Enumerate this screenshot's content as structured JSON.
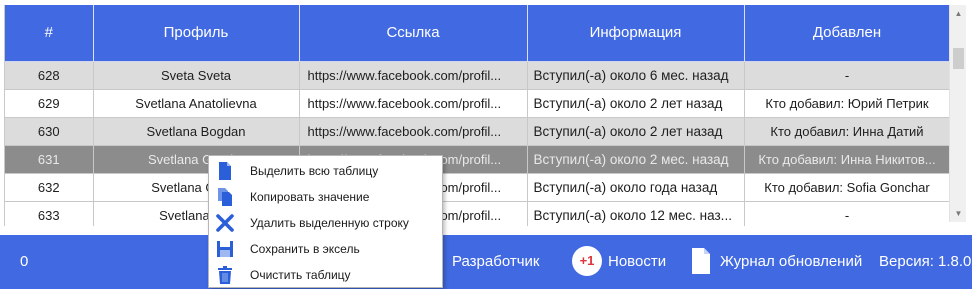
{
  "table": {
    "columns": [
      "#",
      "Профиль",
      "Ссылка",
      "Информация",
      "Добавлен"
    ],
    "rows": [
      {
        "num": "628",
        "profile": "Sveta Sveta",
        "link": "https://www.facebook.com/profil...",
        "info": "Вступил(-а)  около 6 мес. назад",
        "added": "-"
      },
      {
        "num": "629",
        "profile": "Svetlana Anatolievna",
        "link": "https://www.facebook.com/profil...",
        "info": "Вступил(-а)  около 2 лет назад",
        "added": "Кто добавил: Юрий Петрик"
      },
      {
        "num": "630",
        "profile": "Svetlana Bogdan",
        "link": "https://www.facebook.com/profil...",
        "info": "Вступил(-а)  около 2 лет назад",
        "added": "Кто добавил: Инна Датий"
      },
      {
        "num": "631",
        "profile": "Svetlana Gavri...",
        "link": "https://www.facebook.com/profil...",
        "info": "Вступил(-а)  около 2 мес. назад",
        "added": "Кто добавил: Инна Никитов..."
      },
      {
        "num": "632",
        "profile": "Svetlana Gau...",
        "link": "https://www.facebook.com/profil...",
        "info": "Вступил(-а)  около года назад",
        "added": "Кто добавил: Sofia Gonchar"
      },
      {
        "num": "633",
        "profile": "Svetlana K...",
        "link": "https://www.facebook.com/profil...",
        "info": "Вступил(-а)  около 12 мес. наз...",
        "added": "-"
      }
    ]
  },
  "footer": {
    "count": "0",
    "developer": "Разработчик",
    "news_badge": "+1",
    "news": "Новости",
    "changelog": "Журнал обновлений",
    "version": "Версия: 1.8.0"
  },
  "context_menu": {
    "items": [
      {
        "label": "Выделить всю таблицу",
        "icon": "document-icon"
      },
      {
        "label": "Копировать значение",
        "icon": "copy-icon"
      },
      {
        "label": "Удалить выделенную строку",
        "icon": "delete-x-icon"
      },
      {
        "label": "Сохранить в эксель",
        "icon": "save-icon"
      },
      {
        "label": "Очистить таблицу",
        "icon": "trash-icon"
      }
    ]
  },
  "colors": {
    "header_blue": "#4169e1",
    "selected_row": "#8c8c8c",
    "icon_blue": "#2b5fd9"
  }
}
